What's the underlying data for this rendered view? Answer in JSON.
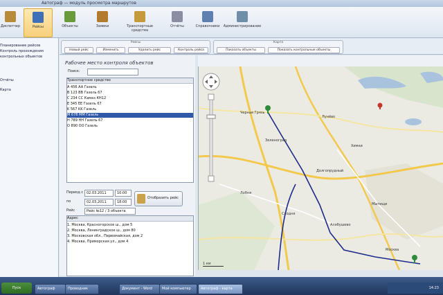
{
  "window": {
    "title": "Автограф — модуль просмотра маршрутов"
  },
  "ribbon": {
    "items": [
      {
        "label": "Диспетчер",
        "active": false
      },
      {
        "label": "Рейсы",
        "active": true
      },
      {
        "label": "Объекты",
        "active": false
      },
      {
        "label": "Заявки",
        "active": false
      },
      {
        "label": "Транспортные средства",
        "active": false
      },
      {
        "label": "Отчёты",
        "active": false
      },
      {
        "label": "Справочники",
        "active": false
      },
      {
        "label": "Администрирование",
        "active": false
      }
    ]
  },
  "sidebar": {
    "items": [
      "Планирование рейсов",
      "Контроль прохождения",
      "контрольных объектов",
      "Отчёты",
      "Карта"
    ]
  },
  "toolbar": {
    "group1_title": "Рейсы",
    "group2_title": "Карта",
    "group1_buttons": [
      "Новый рейс",
      "Изменить",
      "Удалить рейс",
      "Контроль рейса"
    ],
    "group2_buttons": [
      "Показать объекты",
      "Показать контрольные объекты"
    ]
  },
  "panel": {
    "title": "Рабочее место контроля объектов",
    "search_label": "Поиск:",
    "list_header": "Транспортное средство",
    "items": [
      "A 456 AA Газель",
      "B 123 BB Газель 67",
      "C 234 CC Камаз КН12",
      "E 345 EE Газель 67",
      "K 567 KK Газель",
      "M 678 MM Газель",
      "H 789 HH Газель 67",
      "O 890 OO Газель"
    ],
    "selected_index": 5,
    "period_from_label": "Период с",
    "period_to_label": "по",
    "date_from": "02.03.2011",
    "time_from": "10:00",
    "date_to": "02.03.2011",
    "time_to": "18:00",
    "route_label": "Рейс",
    "route_value": "Рейс №12 / 3 объекта",
    "build_button": "Отобразить рейс",
    "points_header": "Адрес",
    "points": [
      "1. Москва, Красногорское ш., дом 5",
      "2. Москва, Ленинградское ш., дом 80",
      "3. Московская обл., Первомайская, дом 2",
      "4. Москва, Приморская ул., дом 4"
    ]
  },
  "map": {
    "scale_label": "1 км",
    "labels": [
      "Черная Грязь",
      "Лунёво",
      "Зеленоград",
      "Химки",
      "Долгопрудный",
      "Лобня",
      "Сходня",
      "Алабушево",
      "Мытищи",
      "Москва"
    ],
    "route_color": "#1b2a8a"
  },
  "taskbar": {
    "start": "Пуск",
    "buttons": [
      "Автограф",
      "Проводник",
      "Документ - Word",
      "Мой компьютер",
      "Автограф - карта"
    ],
    "active_index": 4,
    "clock": "14:23"
  }
}
